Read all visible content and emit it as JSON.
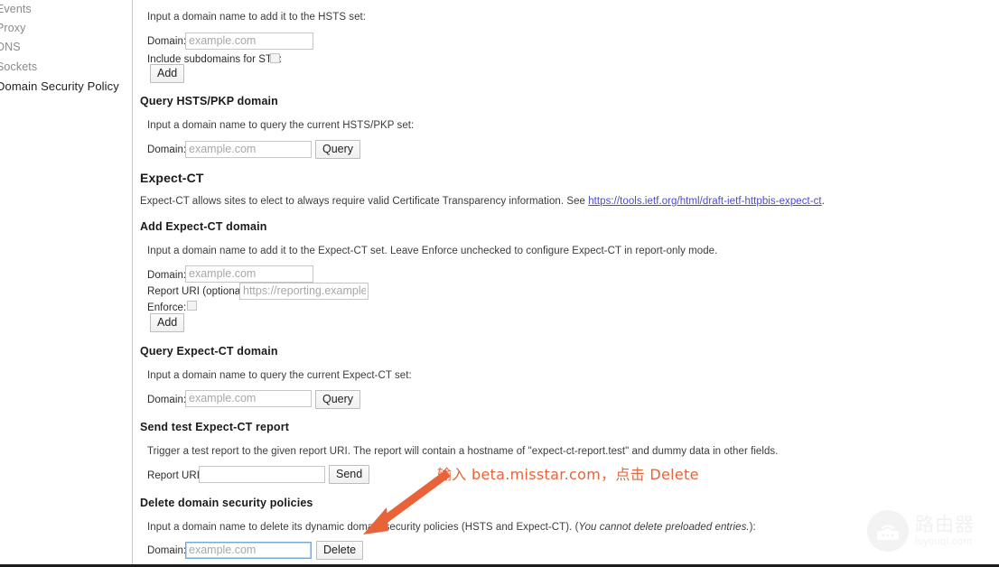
{
  "sidebar": {
    "items": [
      {
        "label": "Events",
        "selected": false
      },
      {
        "label": "Proxy",
        "selected": false
      },
      {
        "label": "DNS",
        "selected": false
      },
      {
        "label": "Sockets",
        "selected": false
      },
      {
        "label": "Domain Security Policy",
        "selected": true
      }
    ]
  },
  "add_hsts": {
    "description": "Input a domain name to add it to the HSTS set:",
    "domain_label": "Domain:",
    "domain_placeholder": "example.com",
    "domain_value": "",
    "subdomains_label": "Include subdomains for STS:",
    "subdomains_checked": false,
    "add_label": "Add"
  },
  "query_hsts": {
    "heading": "Query HSTS/PKP domain",
    "description": "Input a domain name to query the current HSTS/PKP set:",
    "domain_label": "Domain:",
    "domain_placeholder": "example.com",
    "domain_value": "",
    "query_label": "Query"
  },
  "expect_ct": {
    "heading": "Expect-CT",
    "description_before": "Expect-CT allows sites to elect to always require valid Certificate Transparency information. See ",
    "link_text": "https://tools.ietf.org/html/draft-ietf-httpbis-expect-ct",
    "description_after": "."
  },
  "add_expect_ct": {
    "heading": "Add Expect-CT domain",
    "description": "Input a domain name to add it to the Expect-CT set. Leave Enforce unchecked to configure Expect-CT in report-only mode.",
    "domain_label": "Domain:",
    "domain_placeholder": "example.com",
    "domain_value": "",
    "report_uri_label": "Report URI (optional):",
    "report_uri_placeholder": "https://reporting.example.com",
    "report_uri_value": "",
    "enforce_label": "Enforce:",
    "enforce_checked": false,
    "add_label": "Add"
  },
  "query_expect_ct": {
    "heading": "Query Expect-CT domain",
    "description": "Input a domain name to query the current Expect-CT set:",
    "domain_label": "Domain:",
    "domain_placeholder": "example.com",
    "domain_value": "",
    "query_label": "Query"
  },
  "send_report": {
    "heading": "Send test Expect-CT report",
    "description": "Trigger a test report to the given report URI. The report will contain a hostname of \"expect-ct-report.test\" and dummy data in other fields.",
    "report_uri_label": "Report URI:",
    "report_uri_placeholder": "",
    "report_uri_value": "",
    "send_label": "Send"
  },
  "delete_policies": {
    "heading": "Delete domain security policies",
    "description_before": "Input a domain name to delete its dynamic domain security policies (HSTS and Expect-CT). (",
    "description_italic": "You cannot delete preloaded entries.",
    "description_after": "):",
    "domain_label": "Domain:",
    "domain_placeholder": "example.com",
    "domain_value": "",
    "domain_focused": true,
    "delete_label": "Delete"
  },
  "annotation": {
    "text": "输入 beta.misstar.com，点击 Delete",
    "color": "#e8633a"
  },
  "watermark": {
    "cn_text": "路由器",
    "en_text": "luyouqi.com",
    "icon": "router-icon"
  }
}
